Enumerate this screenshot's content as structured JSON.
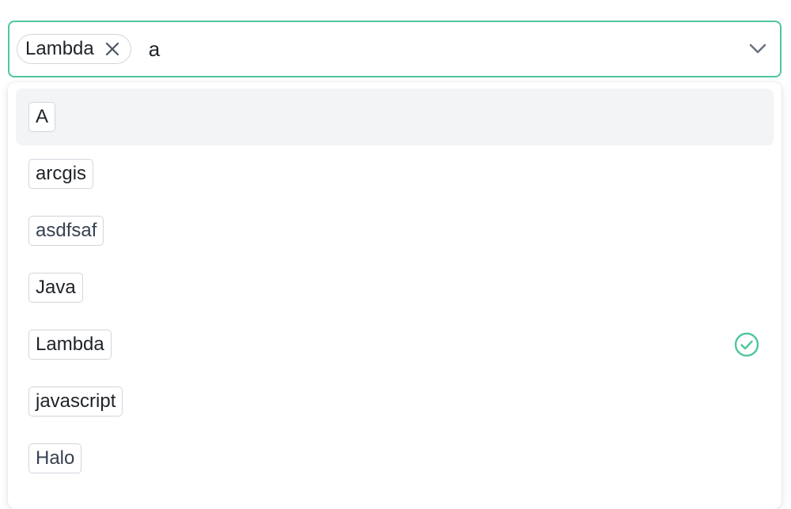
{
  "select": {
    "selected_chip_label": "Lambda",
    "search_value": "a",
    "accent_color": "#4fc79a",
    "icons": {
      "chip_remove": "close-icon",
      "toggle": "chevron-down-icon",
      "selected": "check-circle-icon"
    }
  },
  "options": [
    {
      "label": "A",
      "highlighted": true,
      "selected": false
    },
    {
      "label": "arcgis",
      "highlighted": false,
      "selected": false
    },
    {
      "label": "asdfsaf",
      "highlighted": false,
      "selected": false
    },
    {
      "label": "Java",
      "highlighted": false,
      "selected": false
    },
    {
      "label": "Lambda",
      "highlighted": false,
      "selected": true
    },
    {
      "label": "javascript",
      "highlighted": false,
      "selected": false
    },
    {
      "label": "Halo",
      "highlighted": false,
      "selected": false
    }
  ]
}
